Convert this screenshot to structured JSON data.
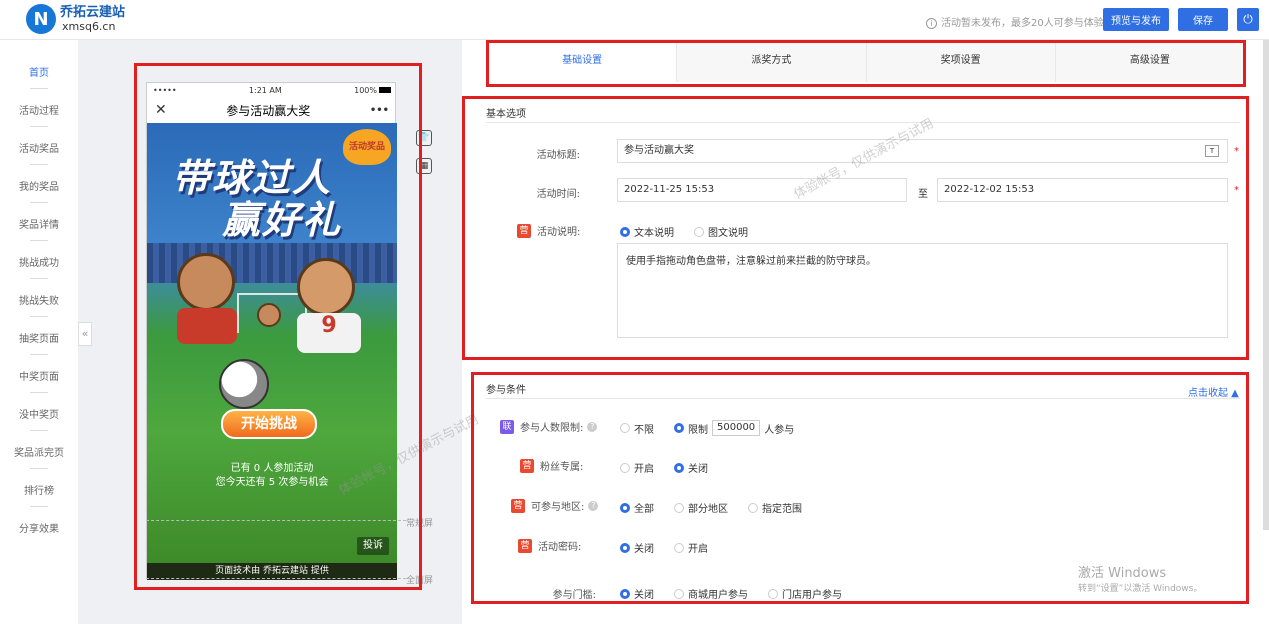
{
  "header": {
    "logo_char": "N",
    "brand_name": "乔拓云建站",
    "brand_domain": "xmsq6.cn",
    "notice": "活动暂未发布，最多20人可参与体验",
    "preview_publish_label": "预览与发布",
    "save_label": "保存",
    "power_icon": "power-icon"
  },
  "sidebar": {
    "items": [
      {
        "label": "首页"
      },
      {
        "label": "活动过程"
      },
      {
        "label": "活动奖品"
      },
      {
        "label": "我的奖品"
      },
      {
        "label": "奖品详情"
      },
      {
        "label": "挑战成功"
      },
      {
        "label": "挑战失败"
      },
      {
        "label": "抽奖页面"
      },
      {
        "label": "中奖页面"
      },
      {
        "label": "没中奖页"
      },
      {
        "label": "奖品派完页"
      },
      {
        "label": "排行榜"
      },
      {
        "label": "分享效果"
      }
    ],
    "collapse_glyph": "«"
  },
  "phone": {
    "signal": "•••••",
    "time": "1:21 AM",
    "battery": "100%",
    "close_glyph": "✕",
    "title": "参与活动赢大奖",
    "more_glyph": "•••",
    "poster_title_line1": "带球过人",
    "poster_title_line2": "赢好礼",
    "badge": "活动奖品",
    "start_button": "开始挑战",
    "joined_text": "已有 0 人参加活动",
    "chances_text": "您今天还有 5 次参与机会",
    "complain_label": "投诉",
    "footer": "页面技术由 乔拓云建站 提供"
  },
  "screen_labels": {
    "normal": "常规屏",
    "full": "全面屏"
  },
  "tabs": [
    {
      "label": "基础设置",
      "active": true
    },
    {
      "label": "派奖方式"
    },
    {
      "label": "奖项设置"
    },
    {
      "label": "高级设置"
    }
  ],
  "basic": {
    "section_title": "基本选项",
    "title_label": "活动标题:",
    "title_value": "参与活动赢大奖",
    "time_label": "活动时间:",
    "start_time": "2022-11-25 15:53",
    "to_label": "至",
    "end_time": "2022-12-02 15:53",
    "desc_tag": "营",
    "desc_label": "活动说明:",
    "desc_opt_text": "文本说明",
    "desc_opt_image": "图文说明",
    "desc_text": "使用手指拖动角色盘带，注意躲过前来拦截的防守球员。",
    "required_mark": "*"
  },
  "conditions": {
    "section_title": "参与条件",
    "collapse_link": "点击收起 ▲",
    "limit_tag": "联",
    "limit_label": "参与人数限制:",
    "limit_opt_none": "不限",
    "limit_opt_limit": "限制",
    "limit_value": "500000",
    "limit_suffix": "人参与",
    "fans_tag": "营",
    "fans_label": "粉丝专属:",
    "fans_on": "开启",
    "fans_off": "关闭",
    "region_tag": "营",
    "region_label": "可参与地区:",
    "region_all": "全部",
    "region_part": "部分地区",
    "region_range": "指定范围",
    "pwd_tag": "营",
    "pwd_label": "活动密码:",
    "pwd_off": "关闭",
    "pwd_on": "开启",
    "threshold_label": "参与门槛:",
    "threshold_off": "关闭",
    "threshold_mall": "商城用户参与",
    "threshold_store": "门店用户参与"
  },
  "watermarks": {
    "text": "体验帐号，仅供演示与试用"
  },
  "windows_activation": {
    "line1": "激活 Windows",
    "line2": "转到“设置”以激活 Windows。"
  }
}
